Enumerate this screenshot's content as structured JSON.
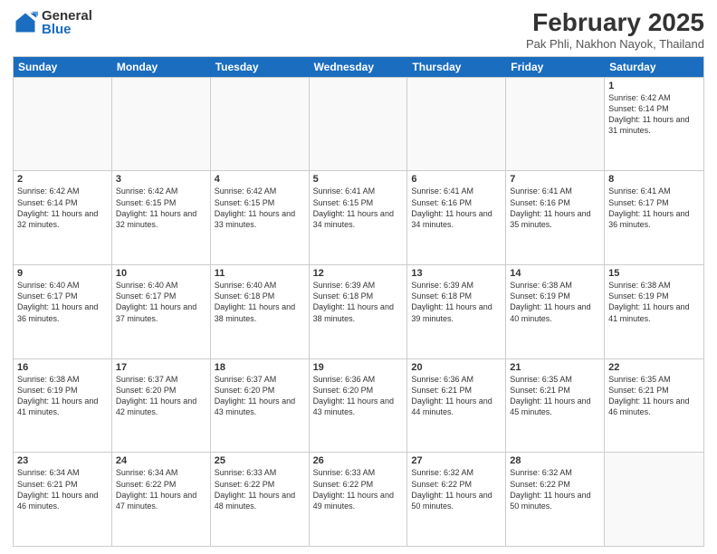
{
  "logo": {
    "general": "General",
    "blue": "Blue"
  },
  "title": {
    "month_year": "February 2025",
    "location": "Pak Phli, Nakhon Nayok, Thailand"
  },
  "calendar": {
    "headers": [
      "Sunday",
      "Monday",
      "Tuesday",
      "Wednesday",
      "Thursday",
      "Friday",
      "Saturday"
    ],
    "rows": [
      [
        {
          "day": "",
          "text": ""
        },
        {
          "day": "",
          "text": ""
        },
        {
          "day": "",
          "text": ""
        },
        {
          "day": "",
          "text": ""
        },
        {
          "day": "",
          "text": ""
        },
        {
          "day": "",
          "text": ""
        },
        {
          "day": "1",
          "text": "Sunrise: 6:42 AM\nSunset: 6:14 PM\nDaylight: 11 hours and 31 minutes."
        }
      ],
      [
        {
          "day": "2",
          "text": "Sunrise: 6:42 AM\nSunset: 6:14 PM\nDaylight: 11 hours and 32 minutes."
        },
        {
          "day": "3",
          "text": "Sunrise: 6:42 AM\nSunset: 6:15 PM\nDaylight: 11 hours and 32 minutes."
        },
        {
          "day": "4",
          "text": "Sunrise: 6:42 AM\nSunset: 6:15 PM\nDaylight: 11 hours and 33 minutes."
        },
        {
          "day": "5",
          "text": "Sunrise: 6:41 AM\nSunset: 6:15 PM\nDaylight: 11 hours and 34 minutes."
        },
        {
          "day": "6",
          "text": "Sunrise: 6:41 AM\nSunset: 6:16 PM\nDaylight: 11 hours and 34 minutes."
        },
        {
          "day": "7",
          "text": "Sunrise: 6:41 AM\nSunset: 6:16 PM\nDaylight: 11 hours and 35 minutes."
        },
        {
          "day": "8",
          "text": "Sunrise: 6:41 AM\nSunset: 6:17 PM\nDaylight: 11 hours and 36 minutes."
        }
      ],
      [
        {
          "day": "9",
          "text": "Sunrise: 6:40 AM\nSunset: 6:17 PM\nDaylight: 11 hours and 36 minutes."
        },
        {
          "day": "10",
          "text": "Sunrise: 6:40 AM\nSunset: 6:17 PM\nDaylight: 11 hours and 37 minutes."
        },
        {
          "day": "11",
          "text": "Sunrise: 6:40 AM\nSunset: 6:18 PM\nDaylight: 11 hours and 38 minutes."
        },
        {
          "day": "12",
          "text": "Sunrise: 6:39 AM\nSunset: 6:18 PM\nDaylight: 11 hours and 38 minutes."
        },
        {
          "day": "13",
          "text": "Sunrise: 6:39 AM\nSunset: 6:18 PM\nDaylight: 11 hours and 39 minutes."
        },
        {
          "day": "14",
          "text": "Sunrise: 6:38 AM\nSunset: 6:19 PM\nDaylight: 11 hours and 40 minutes."
        },
        {
          "day": "15",
          "text": "Sunrise: 6:38 AM\nSunset: 6:19 PM\nDaylight: 11 hours and 41 minutes."
        }
      ],
      [
        {
          "day": "16",
          "text": "Sunrise: 6:38 AM\nSunset: 6:19 PM\nDaylight: 11 hours and 41 minutes."
        },
        {
          "day": "17",
          "text": "Sunrise: 6:37 AM\nSunset: 6:20 PM\nDaylight: 11 hours and 42 minutes."
        },
        {
          "day": "18",
          "text": "Sunrise: 6:37 AM\nSunset: 6:20 PM\nDaylight: 11 hours and 43 minutes."
        },
        {
          "day": "19",
          "text": "Sunrise: 6:36 AM\nSunset: 6:20 PM\nDaylight: 11 hours and 43 minutes."
        },
        {
          "day": "20",
          "text": "Sunrise: 6:36 AM\nSunset: 6:21 PM\nDaylight: 11 hours and 44 minutes."
        },
        {
          "day": "21",
          "text": "Sunrise: 6:35 AM\nSunset: 6:21 PM\nDaylight: 11 hours and 45 minutes."
        },
        {
          "day": "22",
          "text": "Sunrise: 6:35 AM\nSunset: 6:21 PM\nDaylight: 11 hours and 46 minutes."
        }
      ],
      [
        {
          "day": "23",
          "text": "Sunrise: 6:34 AM\nSunset: 6:21 PM\nDaylight: 11 hours and 46 minutes."
        },
        {
          "day": "24",
          "text": "Sunrise: 6:34 AM\nSunset: 6:22 PM\nDaylight: 11 hours and 47 minutes."
        },
        {
          "day": "25",
          "text": "Sunrise: 6:33 AM\nSunset: 6:22 PM\nDaylight: 11 hours and 48 minutes."
        },
        {
          "day": "26",
          "text": "Sunrise: 6:33 AM\nSunset: 6:22 PM\nDaylight: 11 hours and 49 minutes."
        },
        {
          "day": "27",
          "text": "Sunrise: 6:32 AM\nSunset: 6:22 PM\nDaylight: 11 hours and 50 minutes."
        },
        {
          "day": "28",
          "text": "Sunrise: 6:32 AM\nSunset: 6:22 PM\nDaylight: 11 hours and 50 minutes."
        },
        {
          "day": "",
          "text": ""
        }
      ]
    ]
  }
}
